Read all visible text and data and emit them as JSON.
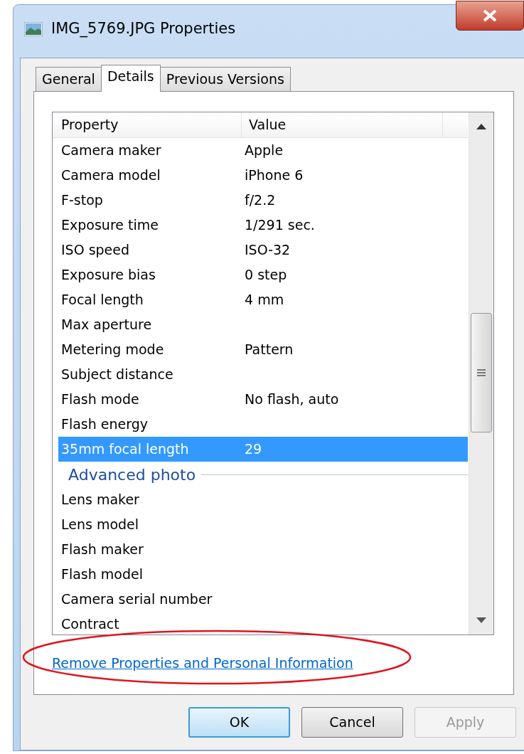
{
  "window": {
    "title": "IMG_5769.JPG Properties"
  },
  "tabs": [
    {
      "label": "General",
      "selected": false
    },
    {
      "label": "Details",
      "selected": true
    },
    {
      "label": "Previous Versions",
      "selected": false
    }
  ],
  "table": {
    "columns": [
      "Property",
      "Value"
    ],
    "rows": [
      {
        "kind": "property",
        "name": "Camera maker",
        "value": "Apple",
        "selected": false
      },
      {
        "kind": "property",
        "name": "Camera model",
        "value": "iPhone 6",
        "selected": false
      },
      {
        "kind": "property",
        "name": "F-stop",
        "value": "f/2.2",
        "selected": false
      },
      {
        "kind": "property",
        "name": "Exposure time",
        "value": "1/291 sec.",
        "selected": false
      },
      {
        "kind": "property",
        "name": "ISO speed",
        "value": "ISO-32",
        "selected": false
      },
      {
        "kind": "property",
        "name": "Exposure bias",
        "value": "0 step",
        "selected": false
      },
      {
        "kind": "property",
        "name": "Focal length",
        "value": "4 mm",
        "selected": false
      },
      {
        "kind": "property",
        "name": "Max aperture",
        "selected": false
      },
      {
        "kind": "property",
        "name": "Metering mode",
        "value": "Pattern",
        "selected": false
      },
      {
        "kind": "property",
        "name": "Subject distance",
        "selected": false
      },
      {
        "kind": "property",
        "name": "Flash mode",
        "value": "No flash, auto",
        "selected": false
      },
      {
        "kind": "property",
        "name": "Flash energy",
        "selected": false
      },
      {
        "kind": "property",
        "name": "35mm focal length",
        "value": "29",
        "selected": true
      },
      {
        "kind": "group",
        "name": "Advanced photo"
      },
      {
        "kind": "property",
        "name": "Lens maker",
        "selected": false
      },
      {
        "kind": "property",
        "name": "Lens model",
        "selected": false
      },
      {
        "kind": "property",
        "name": "Flash maker",
        "selected": false
      },
      {
        "kind": "property",
        "name": "Flash model",
        "selected": false
      },
      {
        "kind": "property",
        "name": "Camera serial number",
        "selected": false
      },
      {
        "kind": "property",
        "name": "Contract",
        "selected": false
      }
    ]
  },
  "link": "Remove Properties and Personal Information",
  "buttons": [
    {
      "label": "OK",
      "kind": "default",
      "disabled": false
    },
    {
      "label": "Cancel",
      "kind": "normal",
      "disabled": false
    },
    {
      "label": "Apply",
      "kind": "normal",
      "disabled": true
    }
  ]
}
